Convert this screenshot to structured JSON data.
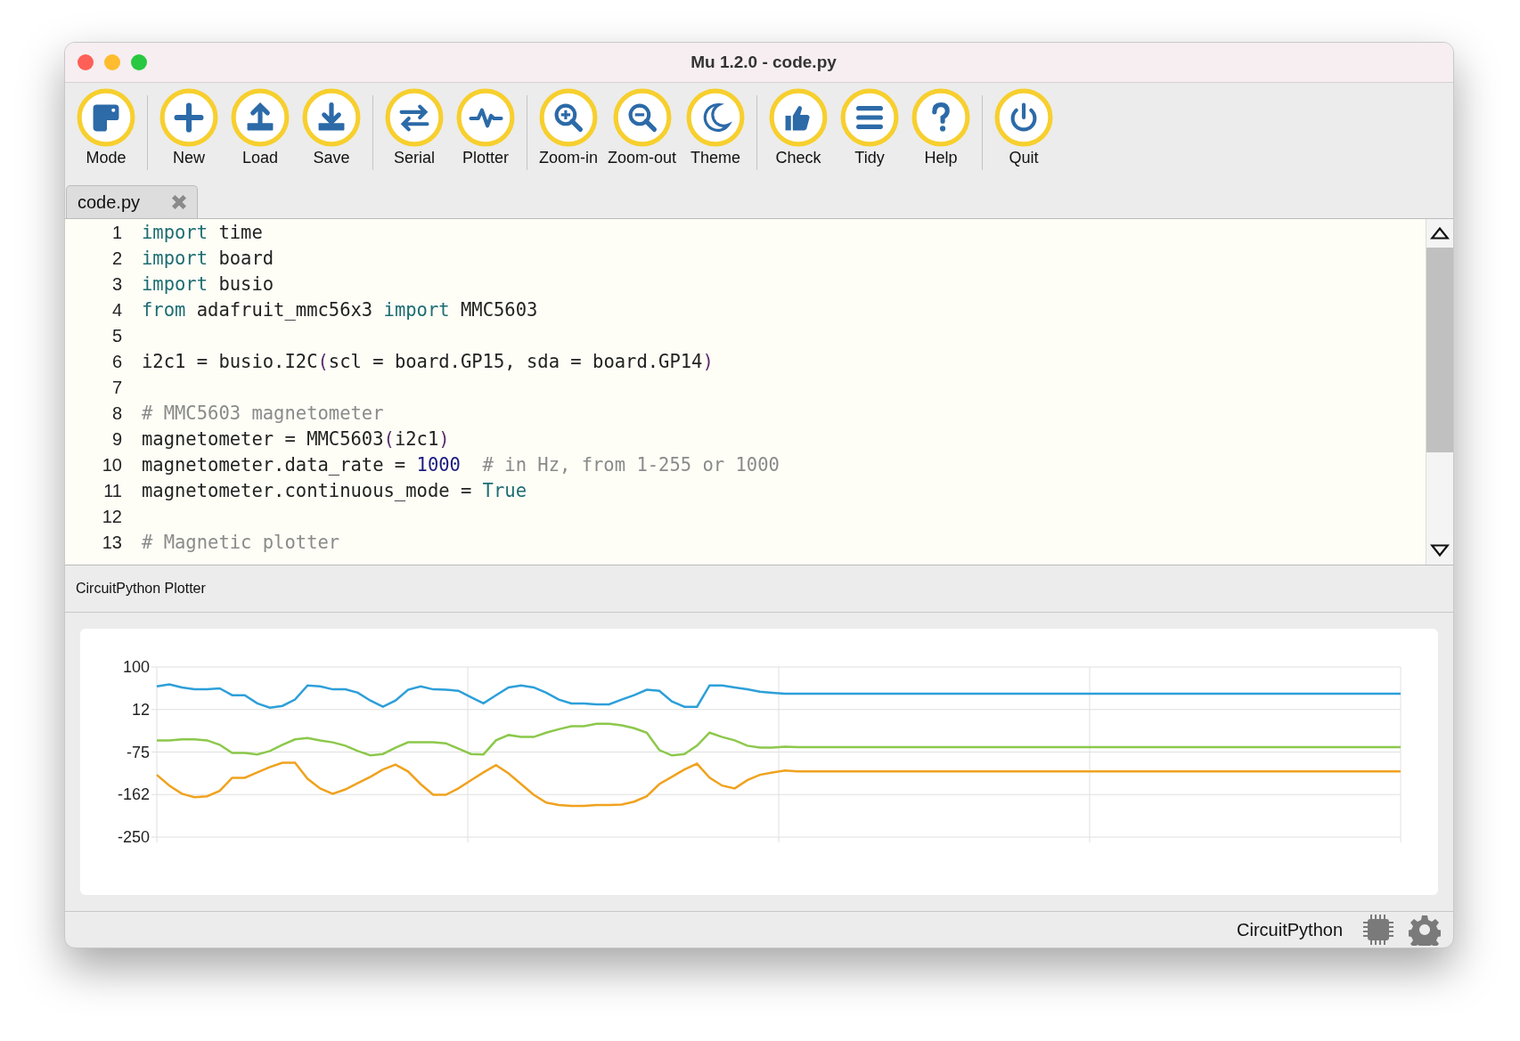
{
  "window": {
    "title": "Mu 1.2.0 - code.py"
  },
  "toolbar": [
    [
      {
        "kind": "mode",
        "label": "Mode"
      }
    ],
    [
      {
        "kind": "new",
        "label": "New"
      },
      {
        "kind": "load",
        "label": "Load"
      },
      {
        "kind": "save",
        "label": "Save"
      }
    ],
    [
      {
        "kind": "serial",
        "label": "Serial"
      },
      {
        "kind": "plotter",
        "label": "Plotter"
      }
    ],
    [
      {
        "kind": "zoom-in",
        "label": "Zoom-in"
      },
      {
        "kind": "zoom-out",
        "label": "Zoom-out"
      },
      {
        "kind": "theme",
        "label": "Theme"
      }
    ],
    [
      {
        "kind": "check",
        "label": "Check"
      },
      {
        "kind": "tidy",
        "label": "Tidy"
      },
      {
        "kind": "help",
        "label": "Help"
      }
    ],
    [
      {
        "kind": "quit",
        "label": "Quit"
      }
    ]
  ],
  "tabs": [
    {
      "label": "code.py"
    }
  ],
  "editor": {
    "lines": [
      {
        "number": "1",
        "tokens": [
          {
            "kind": "keyword",
            "text": "import"
          },
          {
            "kind": "plain",
            "text": " time"
          }
        ]
      },
      {
        "number": "2",
        "tokens": [
          {
            "kind": "keyword",
            "text": "import"
          },
          {
            "kind": "plain",
            "text": " board"
          }
        ]
      },
      {
        "number": "3",
        "tokens": [
          {
            "kind": "keyword",
            "text": "import"
          },
          {
            "kind": "plain",
            "text": " busio"
          }
        ]
      },
      {
        "number": "4",
        "tokens": [
          {
            "kind": "keyword",
            "text": "from"
          },
          {
            "kind": "plain",
            "text": " adafruit_mmc56x3 "
          },
          {
            "kind": "keyword",
            "text": "import"
          },
          {
            "kind": "plain",
            "text": " MMC5603"
          }
        ]
      },
      {
        "number": "5"
      },
      {
        "number": "6",
        "tokens": [
          {
            "kind": "plain",
            "text": "i2c1 = busio.I2C"
          },
          {
            "kind": "paren",
            "text": "("
          },
          {
            "kind": "plain",
            "text": "scl = board.GP15, sda = board.GP14"
          },
          {
            "kind": "paren",
            "text": ")"
          }
        ]
      },
      {
        "number": "7"
      },
      {
        "number": "8",
        "tokens": [
          {
            "kind": "comment",
            "text": "# MMC5603 magnetometer"
          }
        ]
      },
      {
        "number": "9",
        "tokens": [
          {
            "kind": "plain",
            "text": "magnetometer = MMC5603"
          },
          {
            "kind": "paren",
            "text": "("
          },
          {
            "kind": "plain",
            "text": "i2c1"
          },
          {
            "kind": "paren",
            "text": ")"
          }
        ]
      },
      {
        "number": "10",
        "tokens": [
          {
            "kind": "plain",
            "text": "magnetometer.data_rate = "
          },
          {
            "kind": "number",
            "text": "1000"
          },
          {
            "kind": "comment",
            "text": "# in Hz, from 1-255 or 1000"
          }
        ]
      },
      {
        "number": "11",
        "tokens": [
          {
            "kind": "plain",
            "text": "magnetometer.continuous_mode = "
          },
          {
            "kind": "keyword",
            "text": "True"
          }
        ]
      },
      {
        "number": "12"
      },
      {
        "number": "13",
        "tokens": [
          {
            "kind": "comment",
            "text": "# Magnetic plotter"
          }
        ]
      }
    ]
  },
  "plotter": {
    "title": "CircuitPython Plotter",
    "chart_data": {
      "type": "line",
      "grid": true,
      "ylim": [
        -250,
        100
      ],
      "yticks": [
        100,
        {
          "value": 12.5,
          "label": "12"
        },
        -75,
        {
          "value": -162.5,
          "label": "-162"
        },
        -250
      ],
      "series": [
        {
          "color": "#2d9fd9",
          "values": [
            60,
            64,
            58,
            54,
            54,
            56,
            42,
            42,
            25,
            16,
            20,
            33,
            62,
            60,
            54,
            54,
            47,
            31,
            18,
            31,
            53,
            60,
            54,
            53,
            51,
            38,
            25,
            42,
            58,
            62,
            58,
            47,
            33,
            25,
            25,
            23,
            23,
            33,
            42,
            53,
            51,
            29,
            18,
            18,
            62,
            62,
            58,
            54,
            49,
            47,
            45,
            45,
            45,
            45,
            45,
            45,
            45,
            45,
            45,
            45,
            45,
            45,
            45,
            45,
            45,
            45,
            45,
            45,
            45,
            45,
            45,
            45,
            45,
            45,
            45,
            45,
            45,
            45,
            45,
            45,
            45,
            45,
            45,
            45,
            45,
            45,
            45,
            45,
            45,
            45,
            45,
            45,
            45,
            45,
            45,
            45,
            45,
            45,
            45,
            45
          ]
        },
        {
          "color": "#8cc84b",
          "values": [
            -51,
            -51,
            -49,
            -49,
            -51,
            -60,
            -77,
            -77,
            -80,
            -73,
            -60,
            -49,
            -46,
            -51,
            -55,
            -62,
            -73,
            -82,
            -79,
            -66,
            -55,
            -55,
            -55,
            -57,
            -68,
            -79,
            -80,
            -51,
            -40,
            -44,
            -44,
            -35,
            -28,
            -22,
            -22,
            -17,
            -17,
            -20,
            -26,
            -35,
            -71,
            -82,
            -79,
            -62,
            -35,
            -44,
            -51,
            -62,
            -66,
            -66,
            -64,
            -65,
            -65,
            -65,
            -65,
            -65,
            -65,
            -65,
            -65,
            -65,
            -65,
            -65,
            -65,
            -65,
            -65,
            -65,
            -65,
            -65,
            -65,
            -65,
            -65,
            -65,
            -65,
            -65,
            -65,
            -65,
            -65,
            -65,
            -65,
            -65,
            -65,
            -65,
            -65,
            -65,
            -65,
            -65,
            -65,
            -65,
            -65,
            -65,
            -65,
            -65,
            -65,
            -65,
            -65,
            -65,
            -65,
            -65,
            -65,
            -65
          ]
        },
        {
          "color": "#f0a21e",
          "values": [
            -122,
            -144,
            -161,
            -168,
            -166,
            -155,
            -128,
            -128,
            -117,
            -106,
            -97,
            -97,
            -130,
            -150,
            -161,
            -152,
            -139,
            -126,
            -111,
            -101,
            -115,
            -141,
            -163,
            -163,
            -150,
            -133,
            -117,
            -102,
            -119,
            -141,
            -163,
            -179,
            -184,
            -186,
            -186,
            -184,
            -184,
            -183,
            -177,
            -166,
            -141,
            -126,
            -111,
            -99,
            -128,
            -144,
            -150,
            -133,
            -122,
            -117,
            -113,
            -115,
            -115,
            -115,
            -115,
            -115,
            -115,
            -115,
            -115,
            -115,
            -115,
            -115,
            -115,
            -115,
            -115,
            -115,
            -115,
            -115,
            -115,
            -115,
            -115,
            -115,
            -115,
            -115,
            -115,
            -115,
            -115,
            -115,
            -115,
            -115,
            -115,
            -115,
            -115,
            -115,
            -115,
            -115,
            -115,
            -115,
            -115,
            -115,
            -115,
            -115,
            -115,
            -115,
            -115,
            -115,
            -115,
            -115,
            -115,
            -115
          ]
        }
      ]
    }
  },
  "status_bar": {
    "mode": "CircuitPython"
  }
}
